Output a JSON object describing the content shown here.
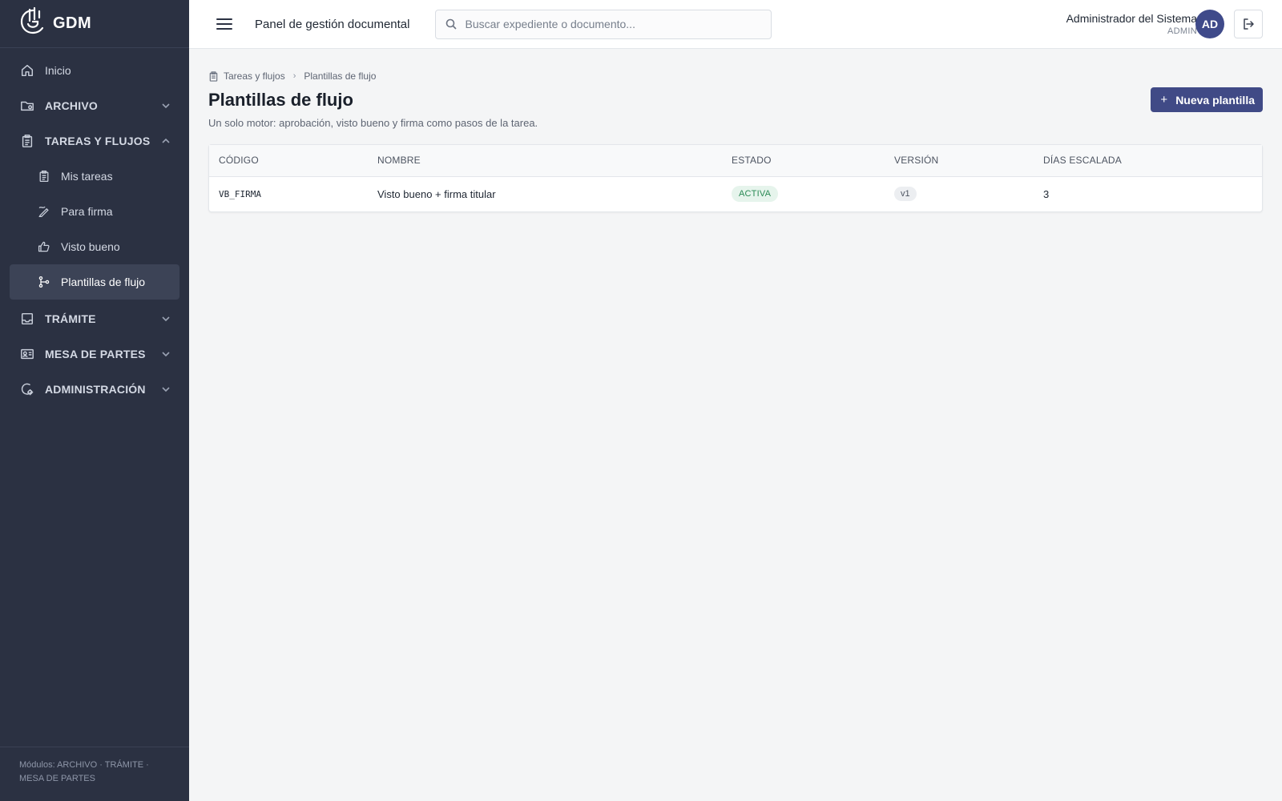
{
  "brand": {
    "name": "GDM"
  },
  "sidebar": {
    "items": [
      {
        "label": "Inicio",
        "icon": "home-icon"
      },
      {
        "label": "ARCHIVO",
        "icon": "folder-icon",
        "expanded": false
      },
      {
        "label": "TAREAS Y FLUJOS",
        "icon": "clipboard-icon",
        "expanded": true,
        "children": [
          {
            "label": "Mis tareas",
            "icon": "clipboard-icon"
          },
          {
            "label": "Para firma",
            "icon": "signature-icon"
          },
          {
            "label": "Visto bueno",
            "icon": "thumbs-up-icon"
          },
          {
            "label": "Plantillas de flujo",
            "icon": "workflow-icon",
            "active": true
          }
        ]
      },
      {
        "label": "TRÁMITE",
        "icon": "inbox-icon",
        "expanded": false
      },
      {
        "label": "MESA DE PARTES",
        "icon": "id-card-icon",
        "expanded": false
      },
      {
        "label": "ADMINISTRACIÓN",
        "icon": "settings-icon",
        "expanded": false
      }
    ],
    "footer": "Módulos: ARCHIVO · TRÁMITE · MESA DE PARTES"
  },
  "topbar": {
    "title": "Panel de gestión documental",
    "search_placeholder": "Buscar expediente o documento...",
    "user_name": "Administrador del Sistema",
    "user_role": "ADMIN",
    "avatar_initials": "AD"
  },
  "breadcrumb": {
    "parent": "Tareas y flujos",
    "current": "Plantillas de flujo"
  },
  "page": {
    "title": "Plantillas de flujo",
    "subtitle": "Un solo motor: aprobación, visto bueno y firma como pasos de la tarea.",
    "new_button": "Nueva plantilla"
  },
  "table": {
    "headers": [
      "CÓDIGO",
      "NOMBRE",
      "ESTADO",
      "VERSIÓN",
      "DÍAS ESCALADA"
    ],
    "rows": [
      {
        "code": "VB_FIRMA",
        "name": "Visto bueno + firma titular",
        "status": "ACTIVA",
        "version": "v1",
        "escalation_days": "3"
      }
    ]
  },
  "colors": {
    "sidebar_bg": "#2b3142",
    "accent": "#404a86",
    "status_active": "#2a8a55"
  }
}
